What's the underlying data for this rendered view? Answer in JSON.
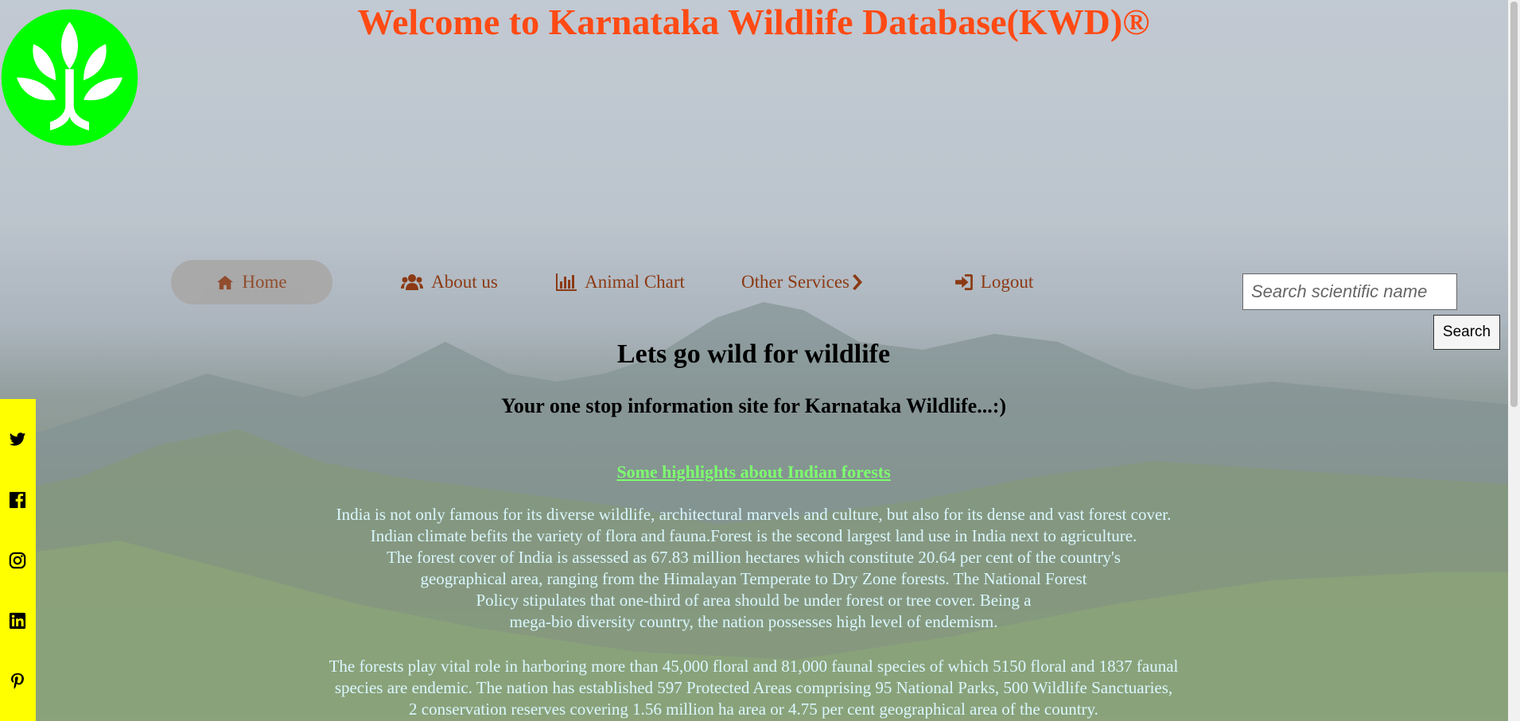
{
  "header": {
    "title": "Welcome to Karnataka Wildlife Database(KWD)®",
    "logo_icon": "leaf-logo-icon",
    "logo_color": "#00ff00"
  },
  "nav": {
    "items": [
      {
        "label": "Home",
        "icon": "home-icon"
      },
      {
        "label": "About us",
        "icon": "users-icon"
      },
      {
        "label": "Animal Chart",
        "icon": "bar-chart-icon"
      },
      {
        "label": "Other Services",
        "icon": "chevron-right-icon"
      },
      {
        "label": "Logout",
        "icon": "sign-in-icon"
      }
    ],
    "active": "Home",
    "text_color": "#8b3a14"
  },
  "search": {
    "placeholder": "Search scientific name",
    "button_label": "Search"
  },
  "social": {
    "background": "#ffff00",
    "icons": [
      "twitter-icon",
      "facebook-icon",
      "instagram-icon",
      "linkedin-icon",
      "pinterest-icon"
    ]
  },
  "main": {
    "headline": "Lets go wild for wildlife",
    "subheadline": "Your one stop information site for Karnataka Wildlife...:)",
    "highlights_link": "Some highlights about Indian forests",
    "paragraph1_lines": [
      "India is not only famous for its diverse wildlife, architectural marvels and culture, but also for its dense and vast forest cover.",
      "Indian climate befits the variety of flora and fauna.Forest is the second largest land use in India next to agriculture.",
      "The forest cover of India is assessed as 67.83 million hectares which constitute 20.64 per cent of the country's",
      "geographical area, ranging from the Himalayan Temperate to Dry Zone forests. The National Forest",
      "Policy stipulates that one-third of area should be under forest or tree cover. Being a",
      "mega-bio diversity country, the nation possesses high level of endemism."
    ],
    "paragraph2_lines": [
      "The forests play vital role in harboring more than 45,000 floral and 81,000 faunal species of which 5150 floral and 1837 faunal",
      "species are endemic. The nation has established 597 Protected Areas comprising 95 National Parks, 500 Wildlife Sanctuaries,",
      "2 conservation reserves covering 1.56 million ha area or 4.75 per cent geographical area of the country."
    ],
    "title_color": "#ff4a14",
    "link_color": "#7dff6e",
    "paragraph_color": "#d9f7ff"
  }
}
